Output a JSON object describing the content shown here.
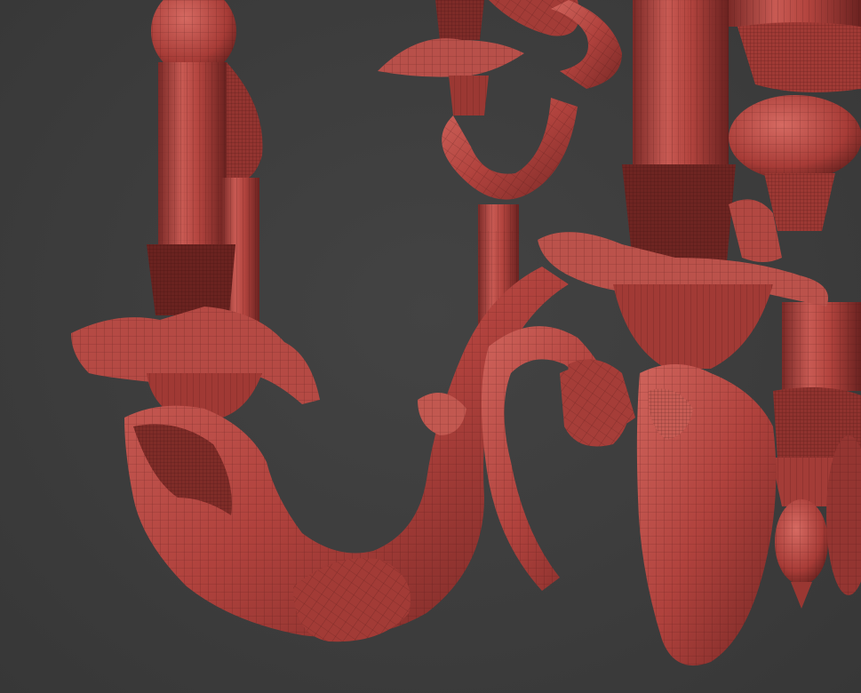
{
  "scene": {
    "subject": "chandelier-wireframe-render",
    "colors": {
      "background": "#3e3e3e",
      "mesh_base": "#b5443f",
      "mesh_light": "#d2645c",
      "mesh_shadow": "#6e2522",
      "wire": "#3a0f0e"
    }
  }
}
